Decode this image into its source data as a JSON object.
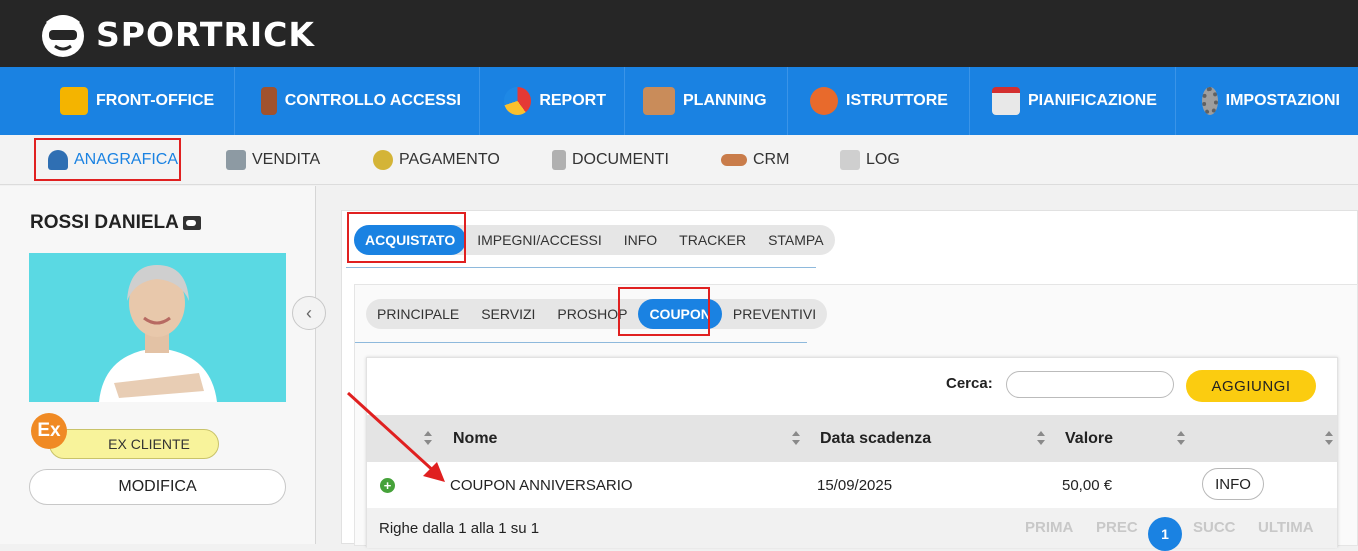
{
  "header": {
    "logo_text": "SPORTRICK"
  },
  "main_nav": [
    {
      "label": "FRONT-OFFICE",
      "icon": "front-office-icon",
      "color": "#f4b400"
    },
    {
      "label": "CONTROLLO ACCESSI",
      "icon": "door-icon",
      "color": "#a0522d"
    },
    {
      "label": "REPORT",
      "icon": "pie-chart-icon",
      "color": "#e53935"
    },
    {
      "label": "PLANNING",
      "icon": "calendar-grid-icon",
      "color": "#c98c5a"
    },
    {
      "label": "ISTRUTTORE",
      "icon": "users-icon",
      "color": "#e86a2c"
    },
    {
      "label": "PIANIFICAZIONE",
      "icon": "calendar-icon",
      "color": "#e8e8e8"
    },
    {
      "label": "IMPOSTAZIONI",
      "icon": "gear-icon",
      "color": "#9e9e9e"
    }
  ],
  "sub_nav": [
    {
      "label": "ANAGRAFICA",
      "icon": "user-icon"
    },
    {
      "label": "VENDITA",
      "icon": "cash-register-icon"
    },
    {
      "label": "PAGAMENTO",
      "icon": "coin-icon"
    },
    {
      "label": "DOCUMENTI",
      "icon": "document-icon"
    },
    {
      "label": "CRM",
      "icon": "handshake-icon"
    },
    {
      "label": "LOG",
      "icon": "log-icon"
    }
  ],
  "client": {
    "name": "ROSSI DANIELA",
    "status_badge": "Ex",
    "status_label": "EX CLIENTE",
    "edit_label": "MODIFICA"
  },
  "tabs_primary": [
    "ACQUISTATO",
    "IMPEGNI/ACCESSI",
    "INFO",
    "TRACKER",
    "STAMPA"
  ],
  "tabs_secondary": [
    "PRINCIPALE",
    "SERVIZI",
    "PROSHOP",
    "COUPON",
    "PREVENTIVI"
  ],
  "table": {
    "search_label": "Cerca:",
    "search_value": "",
    "add_label": "AGGIUNGI",
    "columns": [
      "Nome",
      "Data scadenza",
      "Valore"
    ],
    "rows": [
      {
        "name": "COUPON ANNIVERSARIO",
        "expiry": "15/09/2025",
        "value": "50,00 €",
        "action": "INFO"
      }
    ],
    "footer_info": "Righe dalla 1 alla 1 su 1",
    "pagination": {
      "first": "PRIMA",
      "prev": "PREC",
      "current": "1",
      "next": "SUCC",
      "last": "ULTIMA"
    }
  },
  "colors": {
    "accent": "#1a82e2",
    "header_bg": "#262626",
    "highlight": "#e02020",
    "add_button": "#fbcc10"
  }
}
